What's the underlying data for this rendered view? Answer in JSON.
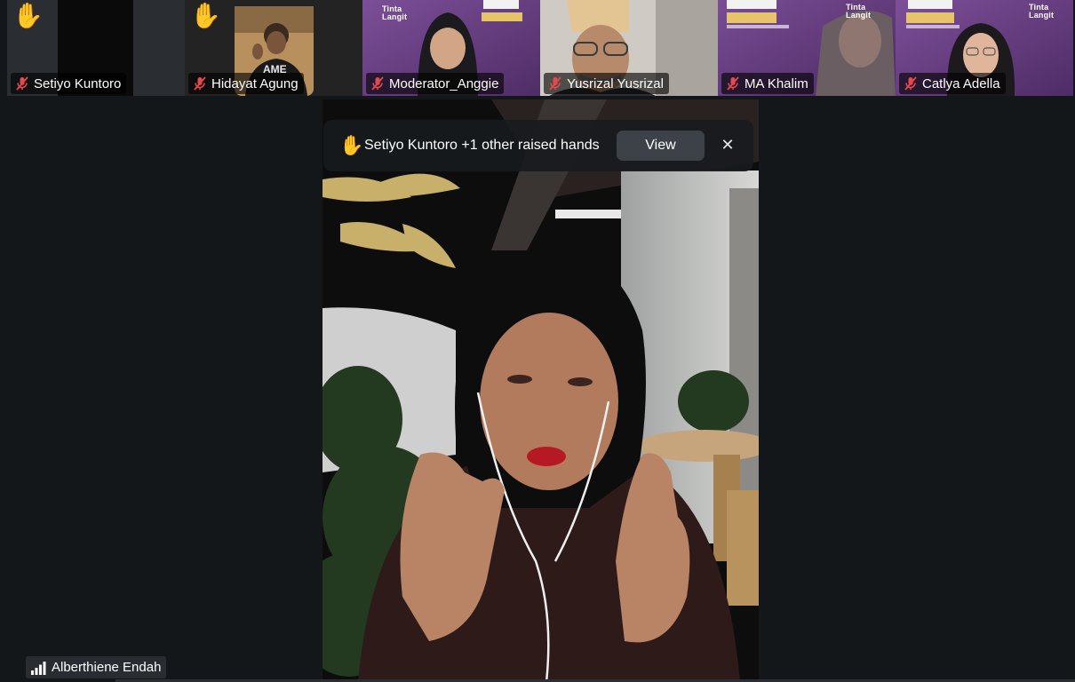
{
  "participants": [
    {
      "name": "Setiyo Kuntoro",
      "muted": true,
      "hand_raised": true,
      "icon": "hand-raised-icon"
    },
    {
      "name": "Hidayat Agung",
      "muted": true,
      "hand_raised": true,
      "icon": "hand-raised-icon"
    },
    {
      "name": "Moderator_Anggie",
      "muted": true,
      "hand_raised": false
    },
    {
      "name": "Yusrizal Yusrizal",
      "muted": true,
      "hand_raised": false
    },
    {
      "name": "MA Khalim",
      "muted": true,
      "hand_raised": false
    },
    {
      "name": "Catlya Adella",
      "muted": true,
      "hand_raised": false
    }
  ],
  "notification": {
    "text": "Setiyo Kuntoro +1 other raised hands",
    "view_label": "View",
    "close_symbol": "✕",
    "hand_symbol": "✋"
  },
  "hand_symbol": "✋",
  "speaker": {
    "name": "Alberthiene Endah",
    "icon": "signal-bars-icon"
  },
  "tinta_logo": "Tinta\nLangit",
  "colors": {
    "background": "#13171a",
    "hand": "#f6c342",
    "muted": "#e5484d",
    "tile_purple": "#6b3f86"
  }
}
